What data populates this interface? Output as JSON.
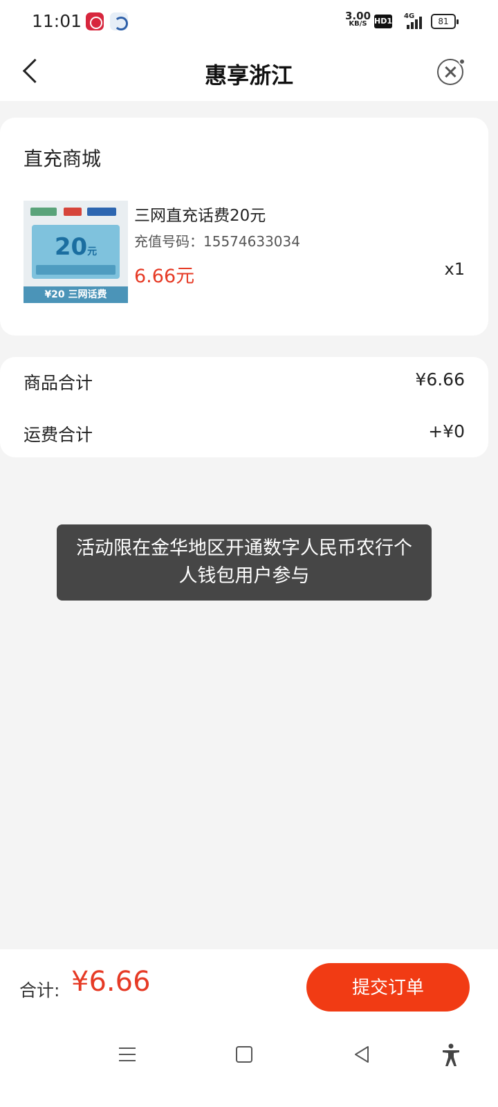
{
  "status_bar": {
    "time": "11:01",
    "net_speed_value": "3.00",
    "net_speed_unit": "KB/S",
    "hd_badge": "HD1",
    "network": "4G",
    "battery": "81",
    "icons": [
      "ecny-app-icon",
      "bank-app-icon"
    ]
  },
  "header": {
    "title": "惠享浙江",
    "back_icon": "back-chevron-icon",
    "close_icon": "close-circle-icon"
  },
  "order": {
    "store_name": "直充商城",
    "product": {
      "name": "三网直充话费20元",
      "recharge_label": "充值号码：15574633034",
      "price": "6.66元",
      "quantity": "x1",
      "thumb": {
        "amount": "20",
        "amount_unit": "元",
        "footer": "¥20 三网话费"
      }
    }
  },
  "totals": {
    "goods_label": "商品合计",
    "goods_value": "¥6.66",
    "shipping_label": "运费合计",
    "shipping_value": "+¥0"
  },
  "toast": {
    "message": "活动限在金华地区开通数字人民币农行个人钱包用户参与"
  },
  "bottom_bar": {
    "total_label": "合计:",
    "total_amount": "¥6.66",
    "submit_label": "提交订单"
  },
  "nav_bar": {
    "icons": [
      "menu-icon",
      "home-icon",
      "back-icon",
      "accessibility-icon"
    ]
  },
  "colors": {
    "accent": "#f13b14",
    "price": "#e63a25",
    "toast_bg": "#464646",
    "page_bg": "#f4f4f4"
  }
}
